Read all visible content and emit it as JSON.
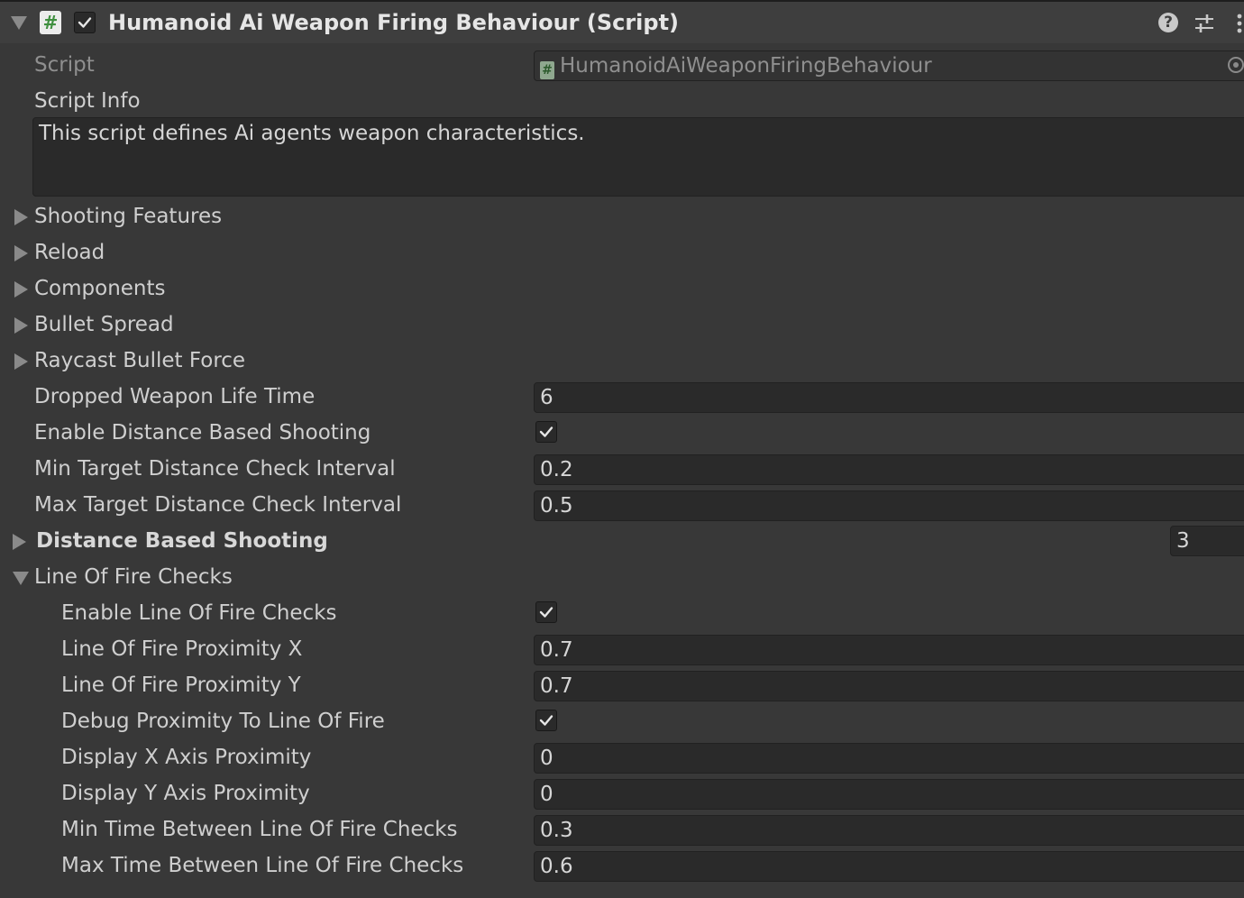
{
  "header": {
    "title": "Humanoid Ai Weapon Firing Behaviour (Script)",
    "script_icon_glyph": "#",
    "enabled": true
  },
  "script_field": {
    "label": "Script",
    "value": "HumanoidAiWeaponFiringBehaviour"
  },
  "script_info": {
    "label": "Script Info",
    "text": "This script defines Ai agents weapon characteristics."
  },
  "foldouts": {
    "shooting_features": "Shooting Features",
    "reload": "Reload",
    "components": "Components",
    "bullet_spread": "Bullet Spread",
    "raycast_bullet_force": "Raycast Bullet Force",
    "distance_based_shooting": "Distance Based Shooting",
    "distance_based_shooting_count": "3",
    "line_of_fire_checks": "Line Of Fire Checks"
  },
  "fields": {
    "dropped_weapon_life_time": {
      "label": "Dropped Weapon Life Time",
      "value": "6"
    },
    "enable_distance_based_shooting": {
      "label": "Enable Distance Based Shooting",
      "checked": true
    },
    "min_target_distance_check_interval": {
      "label": "Min Target Distance Check Interval",
      "value": "0.2"
    },
    "max_target_distance_check_interval": {
      "label": "Max Target Distance Check Interval",
      "value": "0.5"
    }
  },
  "line_of_fire": {
    "enable_checks": {
      "label": "Enable Line Of Fire Checks",
      "checked": true
    },
    "proximity_x": {
      "label": "Line Of Fire Proximity X",
      "value": "0.7"
    },
    "proximity_y": {
      "label": "Line Of Fire Proximity Y",
      "value": "0.7"
    },
    "debug_proximity": {
      "label": "Debug Proximity To Line Of Fire",
      "checked": true
    },
    "display_x_axis": {
      "label": "Display X Axis Proximity",
      "value": "0"
    },
    "display_y_axis": {
      "label": "Display Y Axis Proximity",
      "value": "0"
    },
    "min_time_between": {
      "label": "Min Time Between Line Of Fire Checks",
      "value": "0.3"
    },
    "max_time_between": {
      "label": "Max Time Between Line Of Fire Checks",
      "value": "0.6"
    }
  },
  "colors": {
    "background": "#383838",
    "field_background": "#2a2a2a",
    "text": "#cfcfcf",
    "disabled_text": "#8f8f8f"
  }
}
